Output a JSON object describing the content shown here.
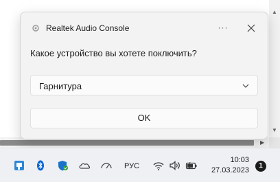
{
  "dialog": {
    "title": "Realtek Audio Console",
    "more_label": "···",
    "question": "Какое устройство вы хотете поключить?",
    "device_select": {
      "selected": "Гарнитура"
    },
    "ok_label": "OK"
  },
  "taskbar": {
    "icons": [
      "file-explorer-icon",
      "bluetooth-icon",
      "windows-security-icon",
      "onedrive-icon",
      "performance-meter-icon"
    ],
    "language": "РУС",
    "tray_icons": [
      "wifi-icon",
      "speaker-icon",
      "battery-icon"
    ],
    "time": "10:03",
    "date": "27.03.2023",
    "notification_count": "1"
  }
}
